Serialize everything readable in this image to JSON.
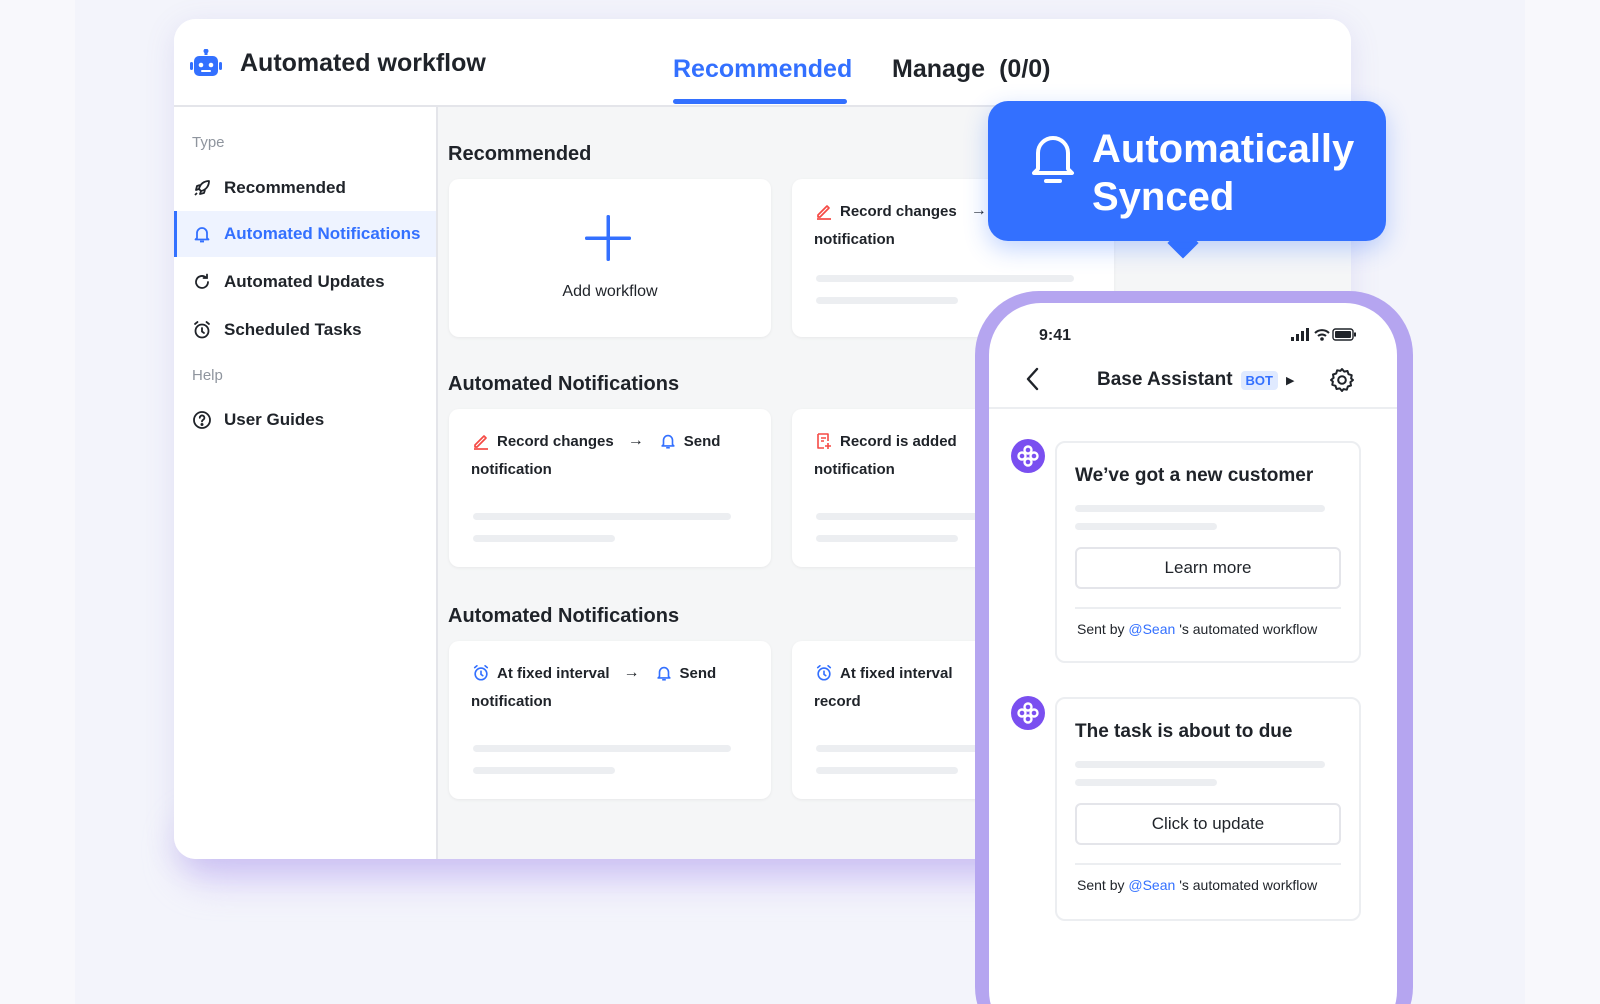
{
  "header": {
    "app_title": "Automated workflow",
    "tabs": [
      {
        "label": "Recommended",
        "active": true
      },
      {
        "label": "Manage",
        "count": "(0/0)",
        "active": false
      }
    ]
  },
  "sidebar": {
    "type_heading": "Type",
    "items": [
      {
        "label": "Recommended",
        "icon": "rocket-icon"
      },
      {
        "label": "Automated Notifications",
        "icon": "bell-icon",
        "active": true
      },
      {
        "label": "Automated Updates",
        "icon": "refresh-icon"
      },
      {
        "label": "Scheduled Tasks",
        "icon": "alarm-clock-icon"
      }
    ],
    "help_heading": "Help",
    "help_items": [
      {
        "label": "User Guides",
        "icon": "question-circle-icon"
      }
    ]
  },
  "sections": [
    {
      "title": "Recommended",
      "cards": [
        {
          "type": "add",
          "label": "Add workflow"
        },
        {
          "trigger": "Record changes",
          "trigger_icon": "pencil-icon",
          "action": "",
          "line2": "notification"
        }
      ]
    },
    {
      "title": "Automated Notifications",
      "cards": [
        {
          "trigger": "Record changes",
          "trigger_icon": "pencil-icon",
          "action": "Send",
          "action_icon": "bell-icon",
          "line2": "notification"
        },
        {
          "trigger": "Record is added",
          "trigger_icon": "record-add-icon",
          "action": "",
          "line2": "notification"
        }
      ]
    },
    {
      "title": "Automated Notifications",
      "cards": [
        {
          "trigger": "At fixed interval",
          "trigger_icon": "alarm-clock-icon",
          "action": "Send",
          "action_icon": "bell-icon",
          "line2": "notification"
        },
        {
          "trigger": "At fixed interval",
          "trigger_icon": "alarm-clock-icon",
          "action": "",
          "line2": "record"
        }
      ]
    }
  ],
  "bubble": {
    "line1": "Automatically",
    "line2": "Synced",
    "icon": "bell-icon"
  },
  "phone": {
    "time": "9:41",
    "title": "Base Assistant",
    "badge": "BOT",
    "messages": [
      {
        "title": "We’ve got a new customer",
        "button": "Learn more",
        "sent_by": "Sent by",
        "user": "@Sean",
        "suffix": "'s automated workflow"
      },
      {
        "title": "The task is about to due",
        "button": "Click to update",
        "sent_by": "Sent by",
        "user": "@Sean",
        "suffix": "'s automated workflow"
      }
    ]
  },
  "colors": {
    "accent": "#3370ff",
    "trigger_red": "#f54a45",
    "avatar_purple": "#7a4ff0",
    "phone_frame": "#b5a5f0"
  }
}
